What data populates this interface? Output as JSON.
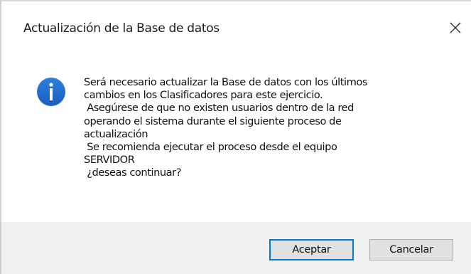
{
  "dialog": {
    "title": "Actualización de la Base de datos",
    "close_icon": "close-icon",
    "info_icon": "info-icon",
    "message_lines": [
      "Será necesario actualizar la Base de datos con los últimos",
      "cambios en los Clasificadores para este ejercicio.",
      " Asegúrese de que no existen usuarios dentro de la red",
      "operando el sistema durante el siguiente proceso de",
      "actualización",
      " Se recomienda ejecutar el proceso desde el equipo",
      "SERVIDOR",
      " ¿deseas continuar?"
    ],
    "buttons": {
      "accept_label": "Aceptar",
      "cancel_label": "Cancelar"
    }
  },
  "colors": {
    "info_icon_blue": "#1f6fce",
    "focus_border": "#0078d7",
    "footer_bg": "#f0f0f0",
    "button_bg": "#e1e1e1"
  }
}
